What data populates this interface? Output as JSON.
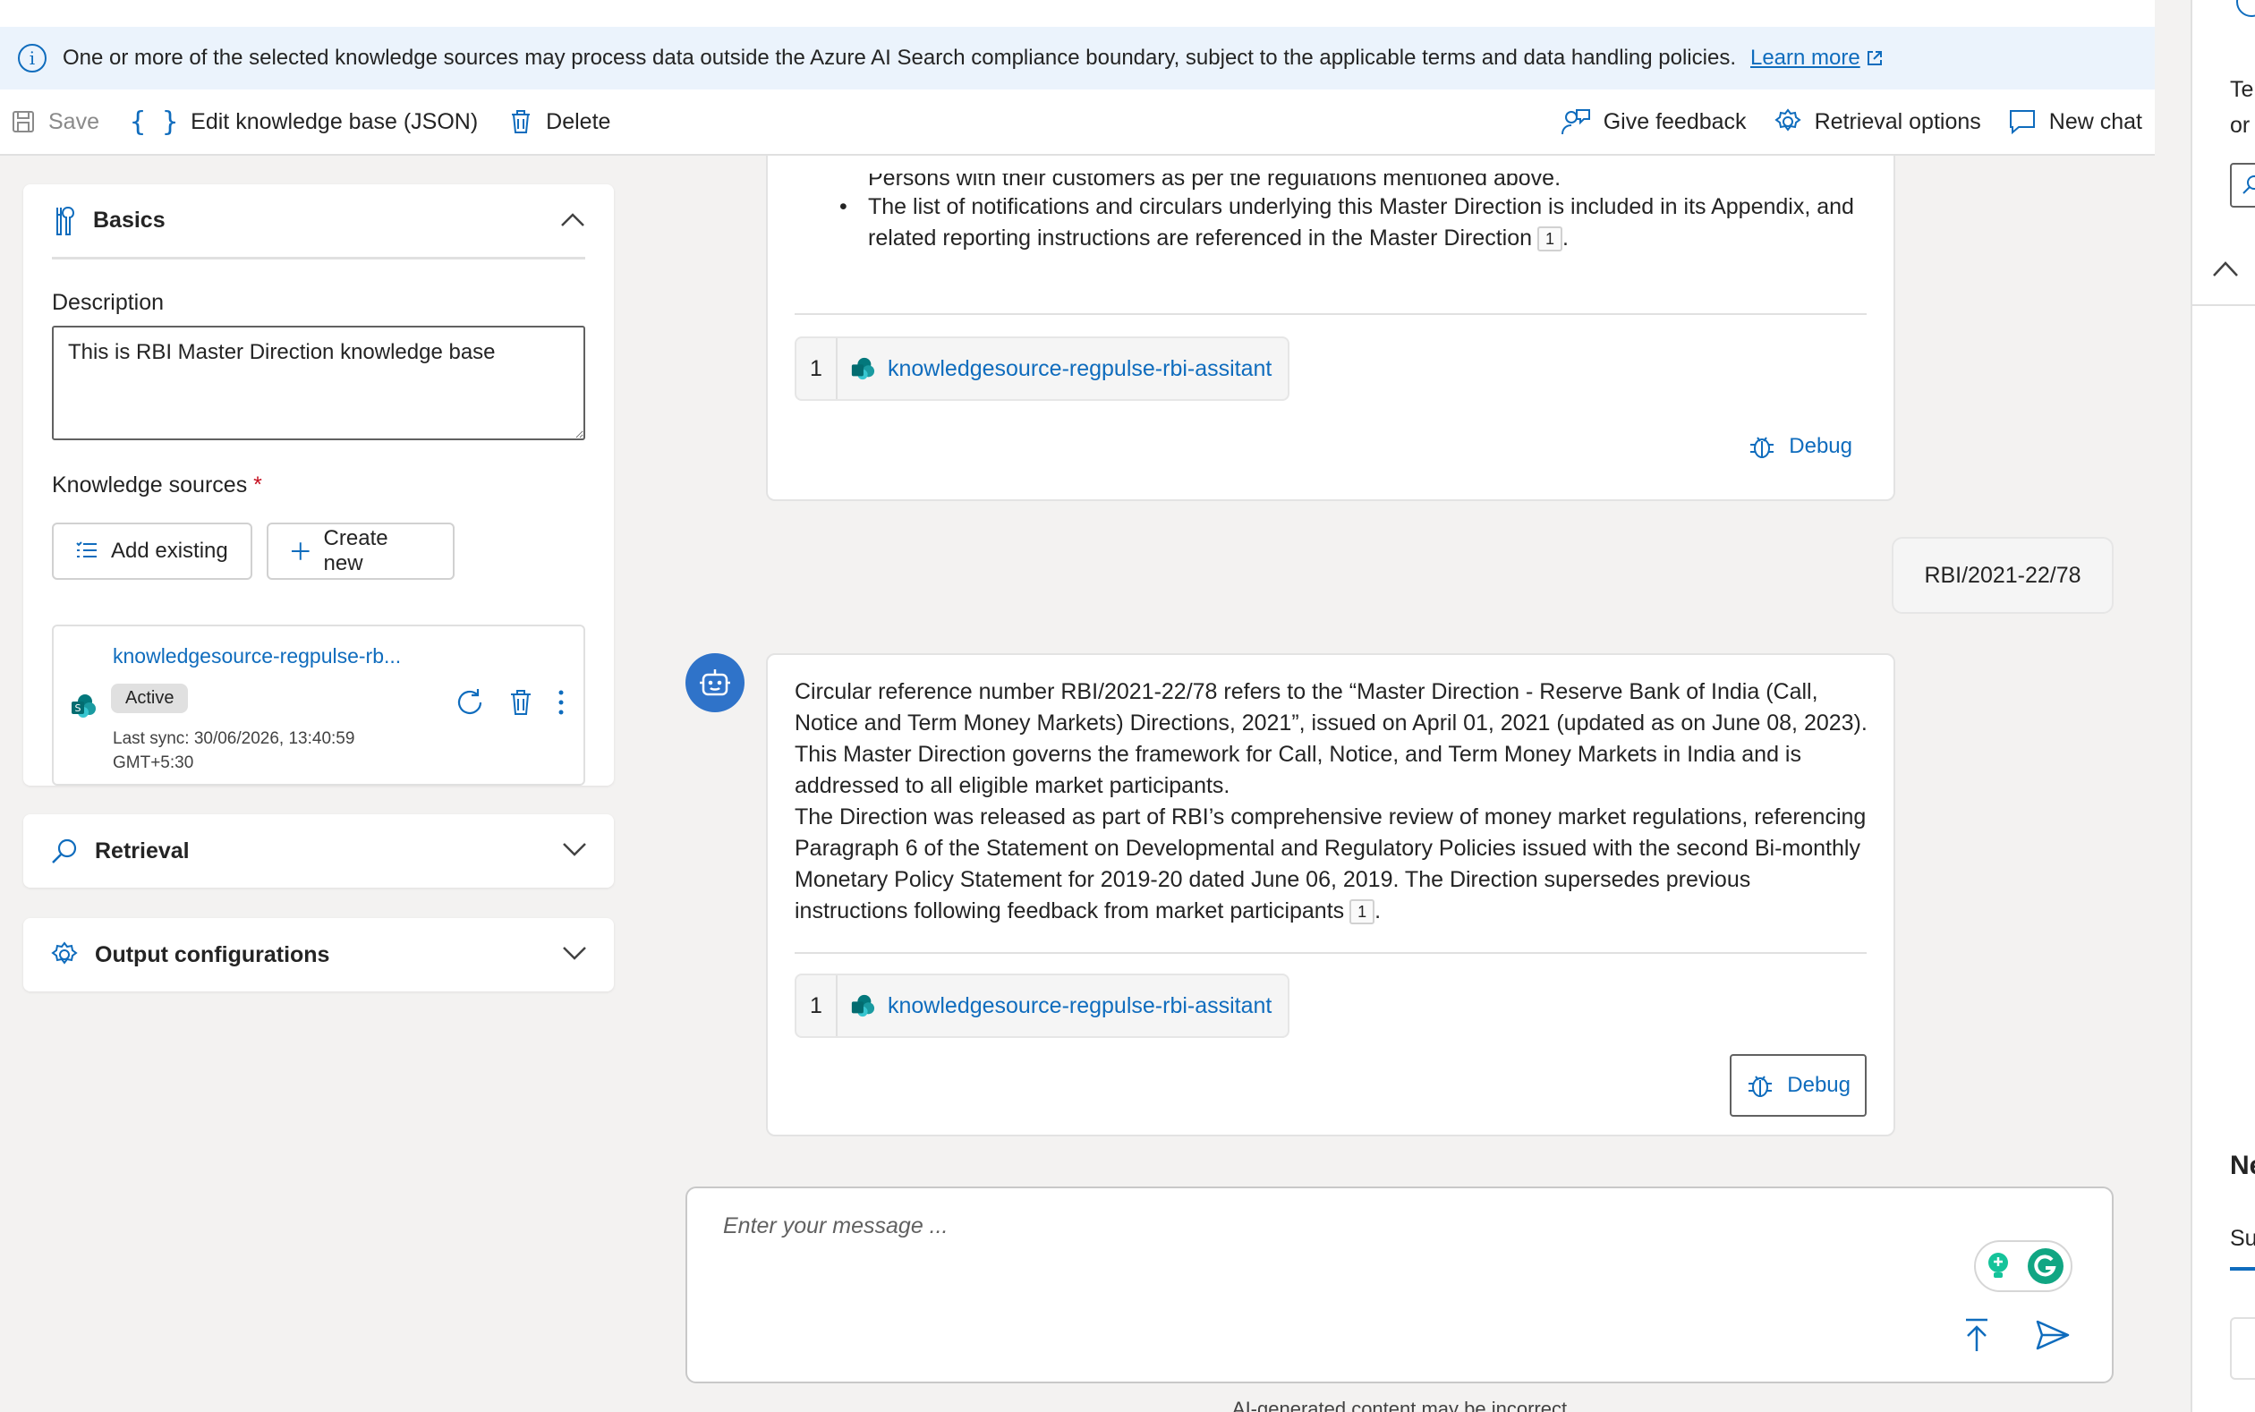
{
  "banner": {
    "message": "One or more of the selected knowledge sources may process data outside the Azure AI Search compliance boundary, subject to the applicable terms and data handling policies.",
    "link": "Learn more"
  },
  "toolbar": {
    "save": "Save",
    "edit_json": "Edit knowledge base (JSON)",
    "delete": "Delete",
    "feedback": "Give feedback",
    "retrieval_options": "Retrieval options",
    "new_chat": "New chat"
  },
  "basics": {
    "title": "Basics",
    "description_label": "Description",
    "description_value": "This is RBI Master Direction knowledge base",
    "knowledge_sources_label": "Knowledge sources",
    "required_mark": "*",
    "add_existing": "Add existing",
    "create_new": "Create new",
    "source": {
      "name": "knowledgesource-regpulse-rb...",
      "status": "Active",
      "last_sync": "Last sync: 30/06/2026, 13:40:59 GMT+5:30"
    }
  },
  "retrieval": {
    "title": "Retrieval"
  },
  "output": {
    "title": "Output configurations"
  },
  "chat": {
    "msg1": {
      "line_partial": "Persons with their customers as per the regulations mentioned above.",
      "bullet": "The list of notifications and circulars underlying this Master Direction is included in its Appendix, and related reporting instructions are referenced in the Master Direction",
      "cite": "1",
      "source_num": "1",
      "source_name": "knowledgesource-regpulse-rbi-assitant",
      "debug": "Debug"
    },
    "user_msg": "RBI/2021-22/78",
    "msg2": {
      "para1": "Circular reference number RBI/2021-22/78 refers to the “Master Direction - Reserve Bank of India (Call, Notice and Term Money Markets) Directions, 2021”, issued on April 01, 2021 (updated as on June 08, 2023). This Master Direction governs the framework for Call, Notice, and Term Money Markets in India and is addressed to all eligible market participants.",
      "para2": "The Direction was released as part of RBI’s comprehensive review of money market regulations, referencing Paragraph 6 of the Statement on Developmental and Regulatory Policies issued with the second Bi-monthly Monetary Policy Statement for 2019-20 dated June 06, 2019. The Direction supersedes previous instructions following feedback from market participants",
      "cite": "1",
      "source_num": "1",
      "source_name": "knowledgesource-regpulse-rbi-assitant",
      "debug": "Debug"
    },
    "composer_placeholder": "Enter your message ...",
    "footer": "AI-generated content may be incorrect"
  },
  "right_panel": {
    "line1": "Tel",
    "line2": "or",
    "heading": "Ne",
    "tab": "Su"
  },
  "colors": {
    "accent": "#0f6cbd",
    "banner_bg": "#ebf3fc",
    "workspace_bg": "#f3f2f1",
    "required": "#c50f1f"
  }
}
